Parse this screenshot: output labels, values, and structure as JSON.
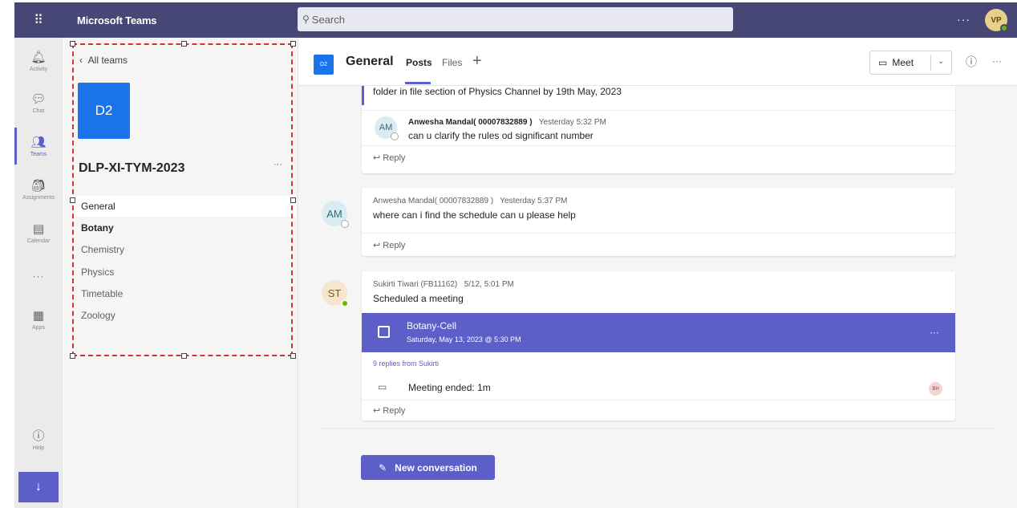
{
  "topbar": {
    "app_title": "Microsoft Teams",
    "search_placeholder": "Search",
    "more_label": "···",
    "avatar_initials": "VP"
  },
  "rail": {
    "items": [
      {
        "label": "Activity",
        "icon": "bell-icon"
      },
      {
        "label": "Chat",
        "icon": "chat-icon"
      },
      {
        "label": "Teams",
        "icon": "teams-icon"
      },
      {
        "label": "Assignments",
        "icon": "assignments-icon"
      },
      {
        "label": "Calendar",
        "icon": "calendar-icon"
      },
      {
        "label": "Apps",
        "icon": "apps-icon"
      },
      {
        "label": "Help",
        "icon": "help-icon"
      }
    ],
    "more_label": "···",
    "download_icon": "download-icon"
  },
  "team": {
    "back_label": "All teams",
    "tile_initials": "D2",
    "name": "DLP-XI-TYM-2023",
    "more_label": "···",
    "channels": [
      "General",
      "Botany",
      "Chemistry",
      "Physics",
      "Timetable",
      "Zoology"
    ]
  },
  "channel_header": {
    "badge": "D2",
    "title": "General",
    "tabs": [
      "Posts",
      "Files"
    ],
    "meet_label": "Meet",
    "more_label": "···"
  },
  "conversation": {
    "partial_message": "folder in file section of Physics Channel by 19th May, 2023",
    "reply_1": {
      "initials": "AM",
      "author": "Anwesha Mandal( 00007832889 )",
      "time": "Yesterday 5:32 PM",
      "text": "can u clarify the rules od significant number"
    },
    "reply_label": "Reply",
    "post_2": {
      "initials": "AM",
      "author": "Anwesha Mandal( 00007832889 )",
      "time": "Yesterday 5:37 PM",
      "text": "where can i find the schedule can u please help"
    },
    "post_3": {
      "initials": "ST",
      "author": "Sukirti Tiwari (FB11162)",
      "time": "5/12, 5:01 PM",
      "text": "Scheduled a meeting",
      "meeting_title": "Botany-Cell",
      "meeting_date": "Saturday, May 13, 2023 @ 5:30 PM",
      "meeting_more": "···",
      "replies_from": "9 replies from Sukirti",
      "meeting_ended": "Meeting ended: 1m",
      "participant_initials": "BH"
    },
    "new_conversation_label": "New conversation"
  },
  "colors": {
    "brand": "#464775",
    "accent": "#5b5fc7",
    "tile": "#1a73e8",
    "selection": "#d13438"
  }
}
